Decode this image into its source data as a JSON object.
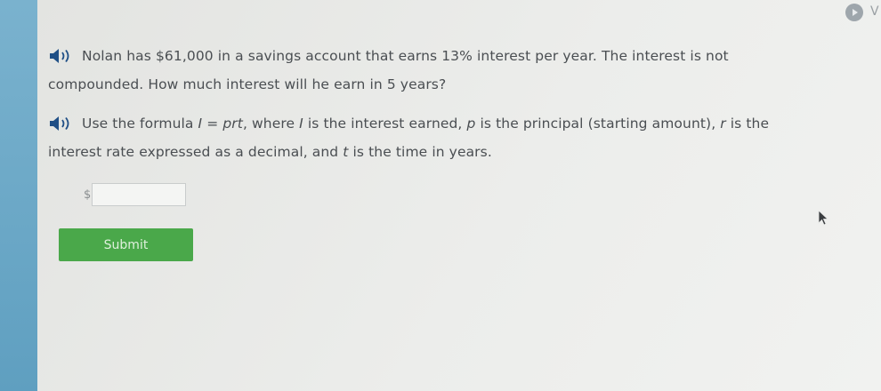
{
  "question": {
    "text": "Nolan has $61,000 in a savings account that earns 13% interest per year. The interest is not compounded. How much interest will he earn in 5 years?"
  },
  "hint": {
    "part1": "Use the formula ",
    "formula": "I = prt",
    "part2": ", where ",
    "var_i": "I",
    "part3": " is the interest earned, ",
    "var_p": "p",
    "part4": " is the principal (starting amount), ",
    "var_r": "r",
    "part5": " is the interest rate expressed as a decimal, and ",
    "var_t": "t",
    "part6": " is the time in years."
  },
  "answer": {
    "currency": "$",
    "value": ""
  },
  "submit_label": "Submit",
  "corner": {
    "letter": "V"
  },
  "colors": {
    "sidebar": "#6aa7c6",
    "submit": "#4aa84a",
    "speaker": "#1f4f86"
  }
}
